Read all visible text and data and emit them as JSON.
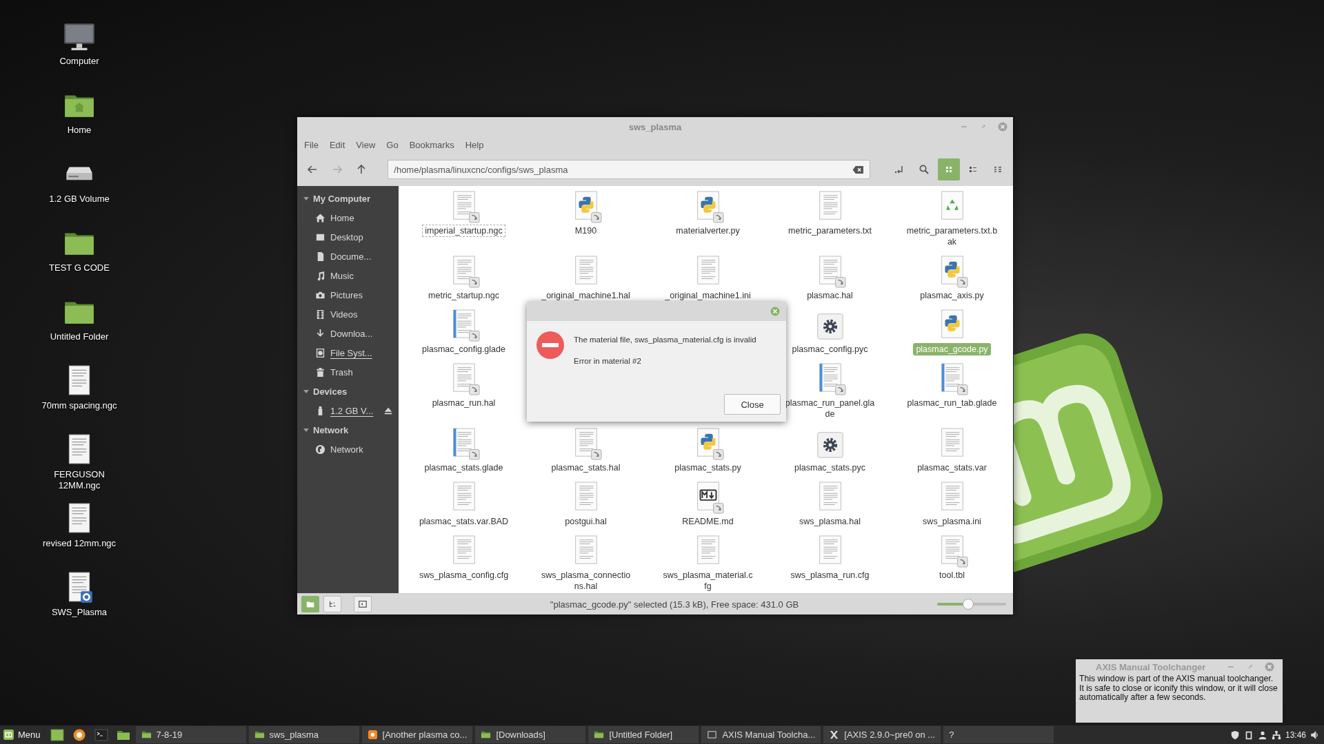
{
  "desktop_icons": [
    {
      "label": "Computer",
      "kind": "computer"
    },
    {
      "label": "Home",
      "kind": "home-folder"
    },
    {
      "label": "1.2 GB Volume",
      "kind": "drive"
    },
    {
      "label": "TEST G CODE",
      "kind": "folder"
    },
    {
      "label": "Untitled Folder",
      "kind": "folder"
    },
    {
      "label": "70mm spacing.ngc",
      "kind": "document"
    },
    {
      "label": "FERGUSON 12MM.ngc",
      "kind": "document"
    },
    {
      "label": "revised 12mm.ngc",
      "kind": "document"
    },
    {
      "label": "SWS_Plasma",
      "kind": "settings-document"
    }
  ],
  "file_manager": {
    "title": "sws_plasma",
    "menu": [
      "File",
      "Edit",
      "View",
      "Go",
      "Bookmarks",
      "Help"
    ],
    "nav_buttons": [
      {
        "kind": "back",
        "disabled": false
      },
      {
        "kind": "forward",
        "disabled": true
      },
      {
        "kind": "up",
        "disabled": false
      }
    ],
    "path": "/home/plasma/linuxcnc/configs/sws_plasma",
    "view_modes": [
      {
        "kind": "icons",
        "selected": true
      },
      {
        "kind": "list",
        "selected": false
      },
      {
        "kind": "compact",
        "selected": false
      }
    ],
    "sidebar": [
      {
        "heading": "My Computer",
        "expanded": true,
        "items": [
          {
            "label": "Home",
            "kind": "home",
            "mounted": false
          },
          {
            "label": "Desktop",
            "kind": "desktop",
            "mounted": false
          },
          {
            "label": "Docume...",
            "kind": "document",
            "mounted": false
          },
          {
            "label": "Music",
            "kind": "music",
            "mounted": false
          },
          {
            "label": "Pictures",
            "kind": "camera",
            "mounted": false
          },
          {
            "label": "Videos",
            "kind": "film",
            "mounted": false
          },
          {
            "label": "Downloa...",
            "kind": "download",
            "mounted": false
          },
          {
            "label": "File Syst...",
            "kind": "disk",
            "mounted": true
          },
          {
            "label": "Trash",
            "kind": "trash",
            "mounted": false
          }
        ]
      },
      {
        "heading": "Devices",
        "expanded": true,
        "items": [
          {
            "label": "1.2 GB V...",
            "kind": "usb",
            "mounted": true,
            "eject": true
          }
        ]
      },
      {
        "heading": "Network",
        "expanded": true,
        "items": [
          {
            "label": "Network",
            "kind": "globe",
            "mounted": false
          }
        ]
      }
    ],
    "files": [
      [
        {
          "name": "imperial_startup.ngc",
          "kind": "text",
          "link": true,
          "selected": false,
          "focused": true
        },
        {
          "name": "M190",
          "kind": "python",
          "link": true,
          "selected": false,
          "focused": false
        },
        {
          "name": "materialverter.py",
          "kind": "python",
          "link": true,
          "selected": false,
          "focused": false
        },
        {
          "name": "metric_parameters.txt",
          "kind": "text",
          "link": false,
          "selected": false,
          "focused": false
        },
        {
          "name": "metric_parameters.txt.bak",
          "kind": "backup",
          "link": false,
          "selected": false,
          "focused": false
        }
      ],
      [
        {
          "name": "metric_startup.ngc",
          "kind": "text",
          "link": true,
          "selected": false,
          "focused": false
        },
        {
          "name": "_original_machine1.hal",
          "kind": "text",
          "link": false,
          "selected": false,
          "focused": false
        },
        {
          "name": "_original_machine1.ini",
          "kind": "text",
          "link": false,
          "selected": false,
          "focused": false
        },
        {
          "name": "plasmac.hal",
          "kind": "text",
          "link": true,
          "selected": false,
          "focused": false
        },
        {
          "name": "plasmac_axis.py",
          "kind": "python",
          "link": true,
          "selected": false,
          "focused": false
        }
      ],
      [
        {
          "name": "plasmac_config.glade",
          "kind": "glade",
          "link": true,
          "selected": false,
          "focused": false
        },
        {
          "name": "plasmac_config.pyc",
          "kind": "compiled",
          "link": false,
          "selected": false,
          "focused": false
        },
        {
          "name": "plasmac_gcode.py",
          "kind": "python",
          "link": false,
          "selected": true,
          "focused": false
        }
      ],
      [
        {
          "name": "plasmac_run.hal",
          "kind": "text",
          "link": true,
          "selected": false,
          "focused": false
        },
        {
          "name": "plasmac_run_panel.glade",
          "kind": "glade",
          "link": true,
          "selected": false,
          "focused": false
        },
        {
          "name": "plasmac_run_tab.glade",
          "kind": "glade",
          "link": true,
          "selected": false,
          "focused": false
        }
      ],
      [
        {
          "name": "plasmac_stats.glade",
          "kind": "glade",
          "link": true,
          "selected": false,
          "focused": false
        },
        {
          "name": "plasmac_stats.hal",
          "kind": "text",
          "link": true,
          "selected": false,
          "focused": false
        },
        {
          "name": "plasmac_stats.py",
          "kind": "python",
          "link": true,
          "selected": false,
          "focused": false
        },
        {
          "name": "plasmac_stats.pyc",
          "kind": "compiled",
          "link": false,
          "selected": false,
          "focused": false
        },
        {
          "name": "plasmac_stats.var",
          "kind": "text",
          "link": false,
          "selected": false,
          "focused": false
        }
      ],
      [
        {
          "name": "plasmac_stats.var.BAD",
          "kind": "text",
          "link": false,
          "selected": false,
          "focused": false
        },
        {
          "name": "postgui.hal",
          "kind": "text",
          "link": false,
          "selected": false,
          "focused": false
        },
        {
          "name": "README.md",
          "kind": "markdown",
          "link": true,
          "selected": false,
          "focused": false
        },
        {
          "name": "sws_plasma.hal",
          "kind": "text",
          "link": false,
          "selected": false,
          "focused": false
        },
        {
          "name": "sws_plasma.ini",
          "kind": "text",
          "link": false,
          "selected": false,
          "focused": false
        }
      ],
      [
        {
          "name": "sws_plasma_config.cfg",
          "kind": "text",
          "link": false,
          "selected": false,
          "focused": false
        },
        {
          "name": "sws_plasma_connections.hal",
          "kind": "text",
          "link": false,
          "selected": false,
          "focused": false
        },
        {
          "name": "sws_plasma_material.cfg",
          "kind": "text",
          "link": false,
          "selected": false,
          "focused": false
        },
        {
          "name": "sws_plasma_run.cfg",
          "kind": "text",
          "link": false,
          "selected": false,
          "focused": false
        },
        {
          "name": "tool.tbl",
          "kind": "text",
          "link": true,
          "selected": false,
          "focused": false
        }
      ]
    ],
    "pane_buttons": [
      {
        "kind": "places",
        "selected": true
      },
      {
        "kind": "tree",
        "selected": false
      },
      {
        "kind": "sidebar-toggle",
        "selected": false
      }
    ],
    "status": "\"plasmac_gcode.py\" selected (15.3 kB), Free space: 431.0 GB",
    "zoom": {
      "level": 0.45
    }
  },
  "dialog": {
    "message": "The material file, sws_plasma_material.cfg is invalid",
    "detail": "Error in material #2",
    "button": "Close"
  },
  "axis_window": {
    "title": "AXIS Manual Toolchanger",
    "message": "This window is part of the AXIS manual toolchanger.  It is safe to close or iconify this window, or it will close automatically after a few seconds."
  },
  "taskbar": {
    "menu_label": "Menu",
    "tasks": [
      {
        "label": "7-8-19",
        "kind": "folder"
      },
      {
        "label": "sws_plasma",
        "kind": "folder"
      },
      {
        "label": "[Another plasma co...",
        "kind": "browser"
      },
      {
        "label": "[Downloads]",
        "kind": "folder"
      },
      {
        "label": "[Untitled Folder]",
        "kind": "folder"
      },
      {
        "label": "AXIS Manual Toolcha...",
        "kind": "window"
      },
      {
        "label": "[AXIS 2.9.0~pre0 on ...",
        "kind": "x-logo"
      },
      {
        "label": "?"
      }
    ],
    "clock": "13:46"
  }
}
